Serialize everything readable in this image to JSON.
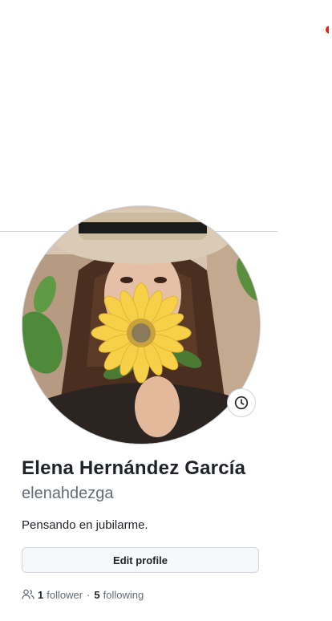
{
  "profile": {
    "full_name": "Elena Hernández García",
    "username": "elenahdezga",
    "bio": "Pensando en jubilarme.",
    "avatar_alt": "avatar-photo",
    "status_icon": "clock-icon"
  },
  "actions": {
    "edit_profile_label": "Edit profile"
  },
  "social": {
    "followers_count": "1",
    "followers_label": "follower",
    "separator": "·",
    "following_count": "5",
    "following_label": "following",
    "icon": "people-icon"
  },
  "colors": {
    "text_primary": "#1f2328",
    "text_muted": "#636c76",
    "border": "#d0d7de",
    "button_bg": "#f6f8fa",
    "accent_red": "#e0261b"
  }
}
